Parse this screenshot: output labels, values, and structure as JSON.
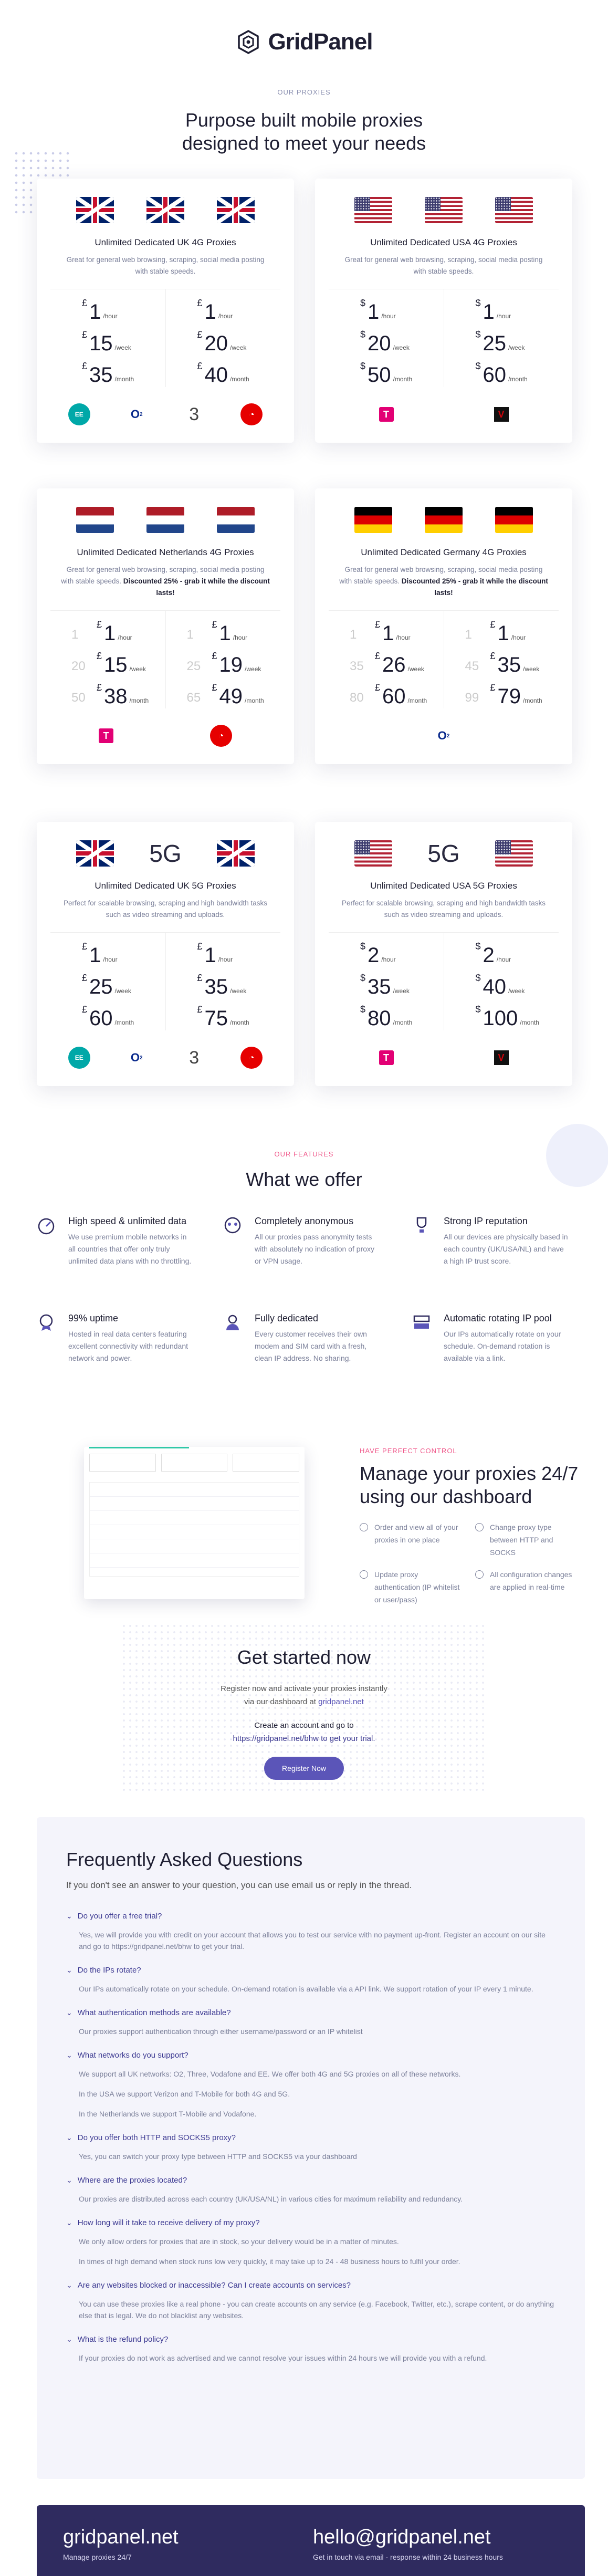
{
  "brand": {
    "name": "GridPanel"
  },
  "proxies": {
    "eyebrow": "OUR PROXIES",
    "title_1": "Purpose built mobile proxies",
    "title_2": "designed to meet your needs"
  },
  "cards": {
    "uk4g": {
      "title": "Unlimited Dedicated UK 4G Proxies",
      "desc": "Great for general web browsing, scraping, social media posting with stable speeds.",
      "c1": {
        "hour": "1",
        "week": "15",
        "month": "35"
      },
      "c2": {
        "hour": "1",
        "week": "20",
        "month": "40"
      }
    },
    "us4g": {
      "title": "Unlimited Dedicated USA 4G Proxies",
      "desc": "Great for general web browsing, scraping, social media posting with stable speeds.",
      "c1": {
        "hour": "1",
        "week": "20",
        "month": "50"
      },
      "c2": {
        "hour": "1",
        "week": "25",
        "month": "60"
      }
    },
    "nl4g": {
      "title": "Unlimited Dedicated Netherlands 4G Proxies",
      "desc": "Great for general web browsing, scraping, social media posting with stable speeds.",
      "desc_bold": "Discounted 25% - grab it while the discount lasts!",
      "c1": {
        "hour_old": "1",
        "hour": "1",
        "week_old": "20",
        "week": "15",
        "month_old": "50",
        "month": "38"
      },
      "c2": {
        "hour_old": "1",
        "hour": "1",
        "week_old": "25",
        "week": "19",
        "month_old": "65",
        "month": "49"
      }
    },
    "de4g": {
      "title": "Unlimited Dedicated Germany 4G Proxies",
      "desc": "Great for general web browsing, scraping, social media posting with stable speeds.",
      "desc_bold": "Discounted 25% - grab it while the discount lasts!",
      "c1": {
        "hour_old": "1",
        "hour": "1",
        "week_old": "35",
        "week": "26",
        "month_old": "80",
        "month": "60"
      },
      "c2": {
        "hour_old": "1",
        "hour": "1",
        "week_old": "45",
        "week": "35",
        "month_old": "99",
        "month": "79"
      }
    },
    "uk5g": {
      "label5g": "5G",
      "title": "Unlimited Dedicated UK 5G Proxies",
      "desc": "Perfect for scalable browsing, scraping and high bandwidth tasks such as video streaming and uploads.",
      "c1": {
        "hour": "1",
        "week": "25",
        "month": "60"
      },
      "c2": {
        "hour": "1",
        "week": "35",
        "month": "75"
      }
    },
    "us5g": {
      "label5g": "5G",
      "title": "Unlimited Dedicated USA 5G Proxies",
      "desc": "Perfect for scalable browsing, scraping and high bandwidth tasks such as video streaming and uploads.",
      "c1": {
        "hour": "2",
        "week": "35",
        "month": "80"
      },
      "c2": {
        "hour": "2",
        "week": "40",
        "month": "100"
      }
    }
  },
  "units": {
    "cur": "£",
    "cur_us": "$",
    "hour": "/hour",
    "week": "/week",
    "month": "/month"
  },
  "features": {
    "eyebrow": "OUR FEATURES",
    "title": "What we offer",
    "items": [
      {
        "title": "High speed & unlimited data",
        "text": "We use premium mobile networks in all countries that offer only truly unlimited data plans with no throttling."
      },
      {
        "title": "Completely anonymous",
        "text": "All our proxies pass anonymity tests with absolutely no indication of proxy or VPN usage."
      },
      {
        "title": "Strong IP reputation",
        "text": "All our devices are physically based in each country (UK/USA/NL) and have a high IP trust score."
      },
      {
        "title": "99% uptime",
        "text": "Hosted in real data centers featuring excellent connectivity with redundant network and power."
      },
      {
        "title": "Fully dedicated",
        "text": "Every customer receives their own modem and SIM card with a fresh, clean IP address. No sharing."
      },
      {
        "title": "Automatic rotating IP pool",
        "text": "Our IPs automatically rotate on your schedule. On-demand rotation is available via a link."
      }
    ]
  },
  "manage": {
    "eyebrow": "HAVE PERFECT CONTROL",
    "title_1": "Manage your proxies 24/7",
    "title_2": "using our dashboard",
    "bullets": [
      "Order and view all of your proxies in one place",
      "Change proxy type between HTTP and SOCKS",
      "Update proxy authentication (IP whitelist or user/pass)",
      "All configuration changes are applied in real-time"
    ]
  },
  "start": {
    "title": "Get started now",
    "line1": "Register now and activate your proxies instantly",
    "line2": "via our dashboard at ",
    "link": "gridpanel.net",
    "line3": "Create an account and go to",
    "line4": "https://gridpanel.net/bhw to get your trial.",
    "button": "Register Now"
  },
  "faq": {
    "title": "Frequently Asked Questions",
    "sub": "If you don't see an answer to your question, you can use email us or reply in the thread.",
    "items": [
      {
        "q": "Do you offer a free trial?",
        "a": [
          "Yes, we will provide you with credit on your account that allows you to test our service with no payment up-front. Register an account on our site and go to https://gridpanel.net/bhw to get your trial."
        ]
      },
      {
        "q": "Do the IPs rotate?",
        "a": [
          "Our IPs automatically rotate on your schedule. On-demand rotation is available via a API link. We support rotation of your IP every 1 minute."
        ]
      },
      {
        "q": "What authentication methods are available?",
        "a": [
          "Our proxies support authentication through either username/password or an IP whitelist"
        ]
      },
      {
        "q": "What networks do you support?",
        "a": [
          "We support all UK networks: O2, Three, Vodafone and EE. We offer both 4G and 5G proxies on all of these networks.",
          "In the USA we support Verizon and T-Mobile for both 4G and 5G.",
          "In the Netherlands we support T-Mobile and Vodafone."
        ]
      },
      {
        "q": "Do you offer both HTTP and SOCKS5 proxy?",
        "a": [
          "Yes, you can switch your proxy type between HTTP and SOCKS5 via your dashboard"
        ]
      },
      {
        "q": "Where are the proxies located?",
        "a": [
          "Our proxies are distributed across each country (UK/USA/NL) in various cities for maximum reliability and redundancy."
        ]
      },
      {
        "q": "How long will it take to receive delivery of my proxy?",
        "a": [
          "We only allow orders for proxies that are in stock, so your delivery would be in a matter of minutes.",
          "In times of high demand when stock runs low very quickly, it may take up to 24 - 48 business hours to fulfil your order."
        ]
      },
      {
        "q": "Are any websites blocked or inaccessible? Can I create accounts on services?",
        "a": [
          "You can use these proxies like a real phone - you can create accounts on any service (e.g. Facebook, Twitter, etc.), scrape content, or do anything else that is legal. We do not blacklist any websites."
        ]
      },
      {
        "q": "What is the refund policy?",
        "a": [
          "If your proxies do not work as advertised and we cannot resolve your issues within 24 hours we will provide you with a refund."
        ]
      }
    ]
  },
  "footer": {
    "site": "gridpanel.net",
    "site_sub": "Manage proxies 24/7",
    "email": "hello@gridpanel.net",
    "email_sub": "Get in touch via email - response within 24 business hours"
  },
  "colors": {
    "accent": "#5b55b8",
    "pink": "#f05a8c",
    "navy": "#2f2b5f"
  }
}
